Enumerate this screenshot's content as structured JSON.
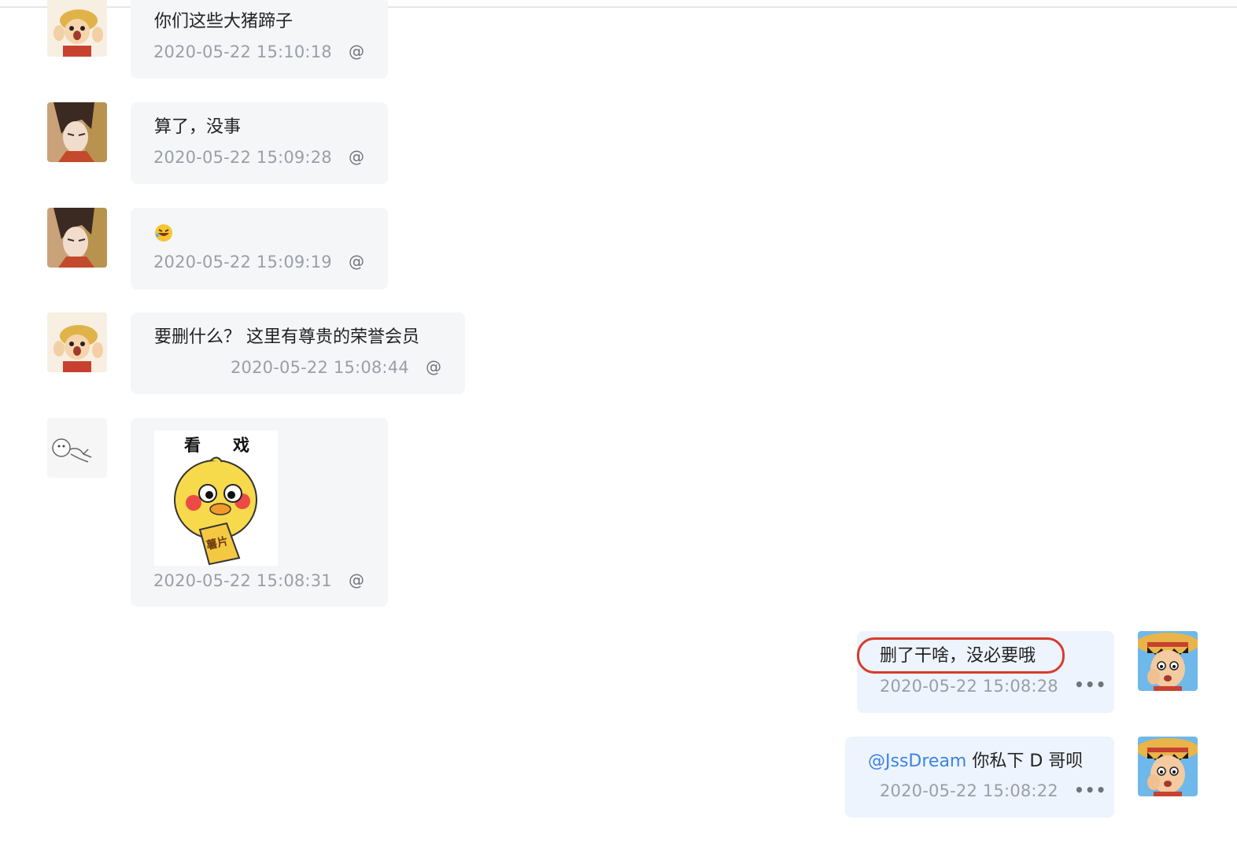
{
  "messages": [
    {
      "sender": "luffy",
      "text": "你们这些大猪蹄子",
      "time": "2020-05-22 15:10:18",
      "action": "@"
    },
    {
      "sender": "anime-man",
      "text": "算了，没事",
      "time": "2020-05-22 15:09:28",
      "action": "@"
    },
    {
      "sender": "anime-man",
      "emoji": "rofl-emoji",
      "time": "2020-05-22 15:09:19",
      "action": "@"
    },
    {
      "sender": "luffy",
      "text": "要删什么？ 这里有尊贵的荣誉会员",
      "time": "2020-05-22 15:08:44",
      "action": "@"
    },
    {
      "sender": "sketch",
      "sticker": {
        "caption_left": "看",
        "caption_right": "戏",
        "sign": "薯片"
      },
      "time": "2020-05-22 15:08:31",
      "action": "@"
    },
    {
      "sender": "self",
      "text": "删了干啥，没必要哦",
      "time": "2020-05-22 15:08:28",
      "action": "•••",
      "highlighted": true
    },
    {
      "sender": "self",
      "mention": "@JssDream",
      "text": " 你私下 D 哥呗",
      "time": "2020-05-22 15:08:22",
      "action": "•••"
    }
  ],
  "colors": {
    "bubble_other": "#f5f6f8",
    "bubble_self": "#eef4fd",
    "time": "#9a9ea6",
    "mention": "#3b82e6",
    "highlight_ring": "#d93a2b"
  }
}
